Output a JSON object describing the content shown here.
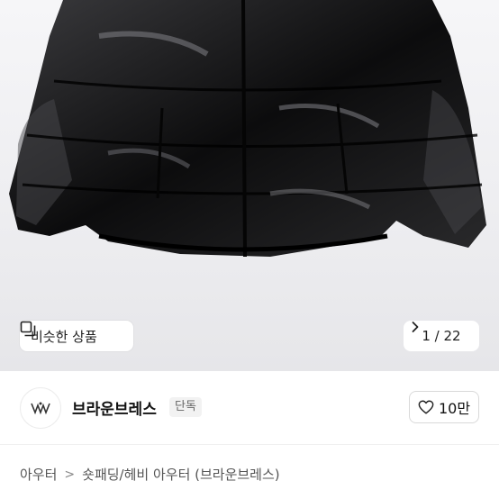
{
  "gallery": {
    "similar_label": "비슷한 상품",
    "current_page": "1",
    "total_pages": "22",
    "page_text": "1 / 22"
  },
  "seller": {
    "name": "브라운브레스",
    "badge": "단독",
    "likes": "10만"
  },
  "breadcrumb": {
    "category": "아우터",
    "subcategory": "숏패딩/헤비 아우터 (브라운브레스)"
  },
  "icons": {
    "similar": "similar-items-icon",
    "next": "chevron-right-icon",
    "like": "heart-outline-icon",
    "logo": "brand-logo"
  }
}
